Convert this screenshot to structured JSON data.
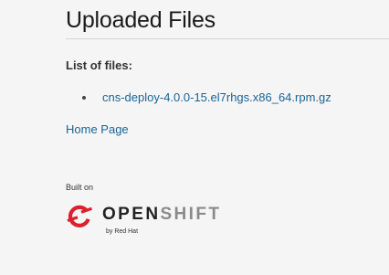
{
  "page": {
    "title": "Uploaded Files",
    "list_heading": "List of files:",
    "files": [
      {
        "name": "cns-deploy-4.0.0-15.el7rhgs.x86_64.rpm.gz"
      }
    ],
    "home_link": "Home Page"
  },
  "footer": {
    "built_on": "Built on",
    "brand": {
      "word_open": "OPEN",
      "word_shift": "SHIFT",
      "sub": "by Red Hat",
      "icon": "openshift-logo-icon"
    }
  },
  "colors": {
    "background": "#f5f5f5",
    "link": "#1a6494",
    "brand_red": "#db212e",
    "brand_gray": "#8a8a8a"
  }
}
